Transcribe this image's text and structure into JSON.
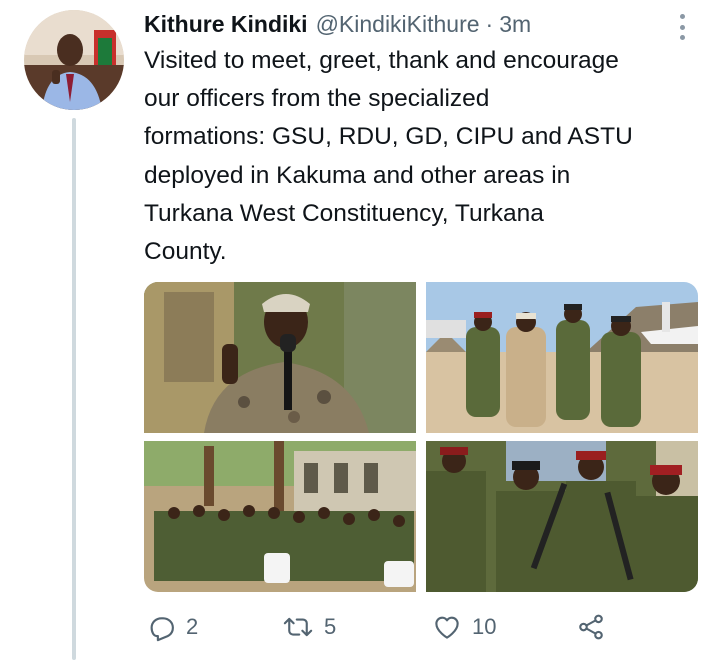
{
  "tweet": {
    "author_name": "Kithure Kindiki",
    "handle": "@KindikiKithure",
    "separator": "·",
    "time": "3m",
    "text_lines": [
      "Visited to meet, greet, thank and encourage",
      "our officers from the specialized",
      "formations: GSU, RDU, GD, CIPU and ASTU",
      "deployed in Kakuma and other areas in",
      "Turkana West Constituency, Turkana",
      "County."
    ]
  },
  "media": {
    "photos": [
      {
        "icon": "photo-speaker-with-microphone"
      },
      {
        "icon": "photo-officers-walking-airstrip"
      },
      {
        "icon": "photo-officers-seated-outdoors"
      },
      {
        "icon": "photo-officers-with-rifles"
      }
    ]
  },
  "actions": {
    "reply_count": "2",
    "retweet_count": "5",
    "like_count": "10"
  },
  "colors": {
    "text": "#0f1419",
    "secondary": "#536471",
    "thread_line": "#cfd9de"
  }
}
